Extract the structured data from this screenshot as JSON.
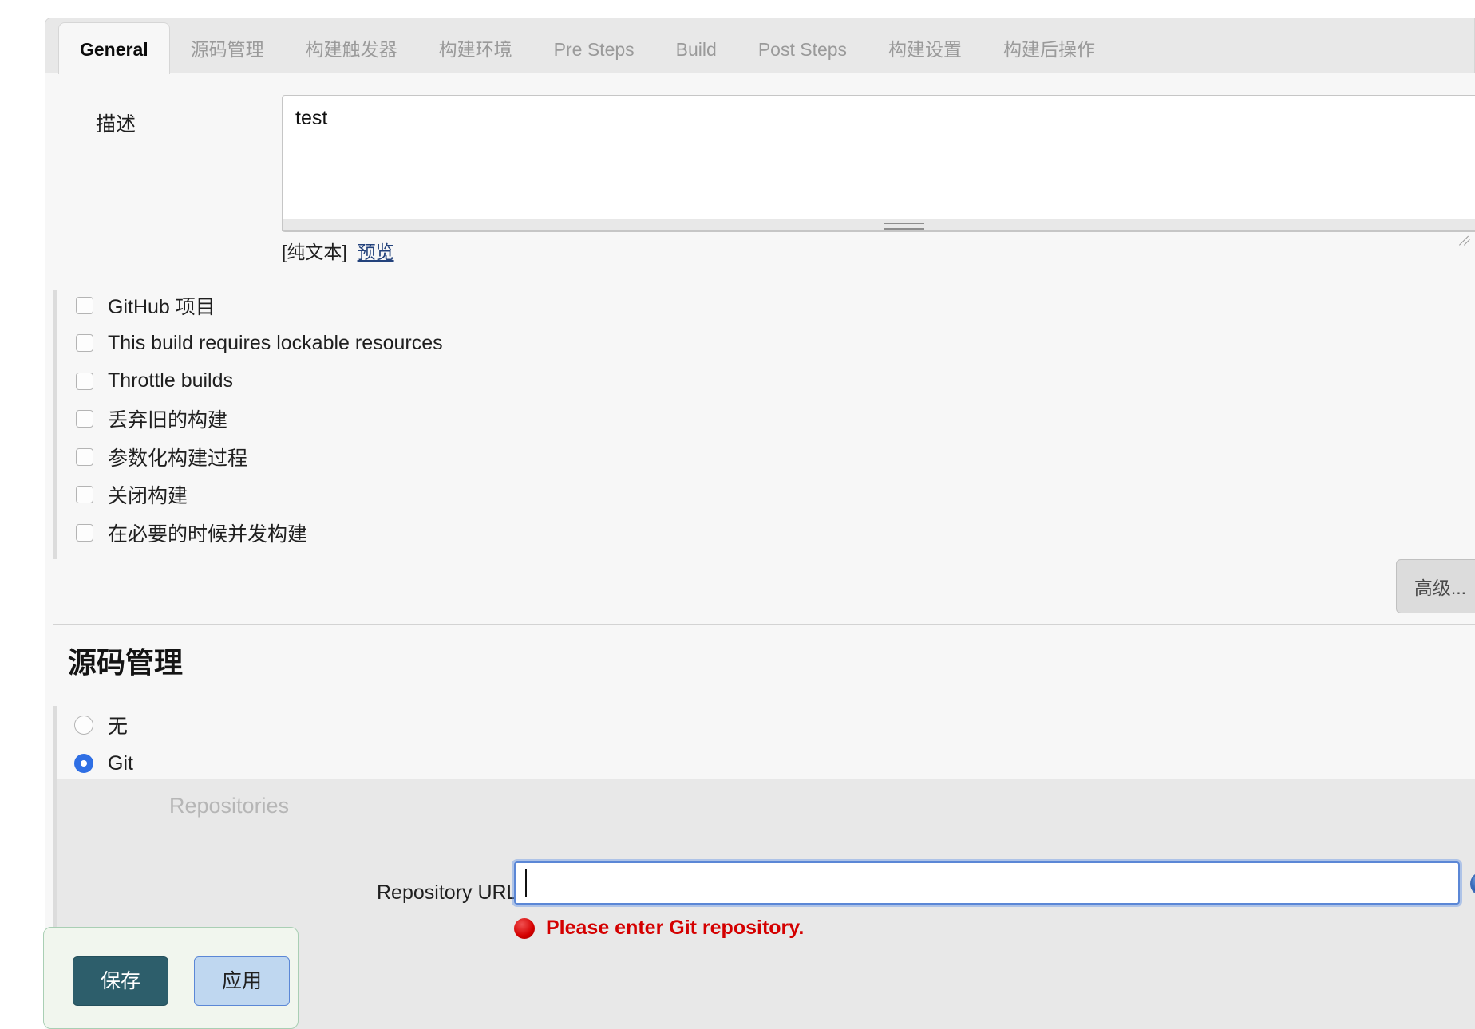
{
  "tabs": [
    {
      "label": "General",
      "active": true
    },
    {
      "label": "源码管理",
      "active": false
    },
    {
      "label": "构建触发器",
      "active": false
    },
    {
      "label": "构建环境",
      "active": false
    },
    {
      "label": "Pre Steps",
      "active": false
    },
    {
      "label": "Build",
      "active": false
    },
    {
      "label": "Post Steps",
      "active": false
    },
    {
      "label": "构建设置",
      "active": false
    },
    {
      "label": "构建后操作",
      "active": false
    }
  ],
  "description": {
    "label": "描述",
    "value": "test",
    "placeholder": "",
    "markup_note": "[纯文本]",
    "preview_link": "预览"
  },
  "checkboxes": [
    {
      "label": "GitHub 项目",
      "checked": false
    },
    {
      "label": "This build requires lockable resources",
      "checked": false
    },
    {
      "label": "Throttle builds",
      "checked": false
    },
    {
      "label": "丢弃旧的构建",
      "checked": false
    },
    {
      "label": "参数化构建过程",
      "checked": false
    },
    {
      "label": "关闭构建",
      "checked": false
    },
    {
      "label": "在必要的时候并发构建",
      "checked": false
    }
  ],
  "advanced_button": "高级...",
  "scm": {
    "title": "源码管理",
    "options": [
      {
        "label": "无",
        "selected": false
      },
      {
        "label": "Git",
        "selected": true
      }
    ],
    "repositories_title": "Repositories",
    "repository_url_label": "Repository URL",
    "repository_url_value": "",
    "repository_url_placeholder": "",
    "error_message": "Please enter Git repository.",
    "help_icon_glyph": "?"
  },
  "savebar": {
    "save_label": "保存",
    "apply_label": "应用"
  },
  "colors": {
    "accent_blue": "#2f6fe4",
    "save_teal": "#2d5e6b",
    "apply_blue": "#bfd7f0",
    "error_red": "#d40000",
    "panel_bg": "#f7f7f7",
    "tabbar_bg": "#e8e8e8"
  }
}
